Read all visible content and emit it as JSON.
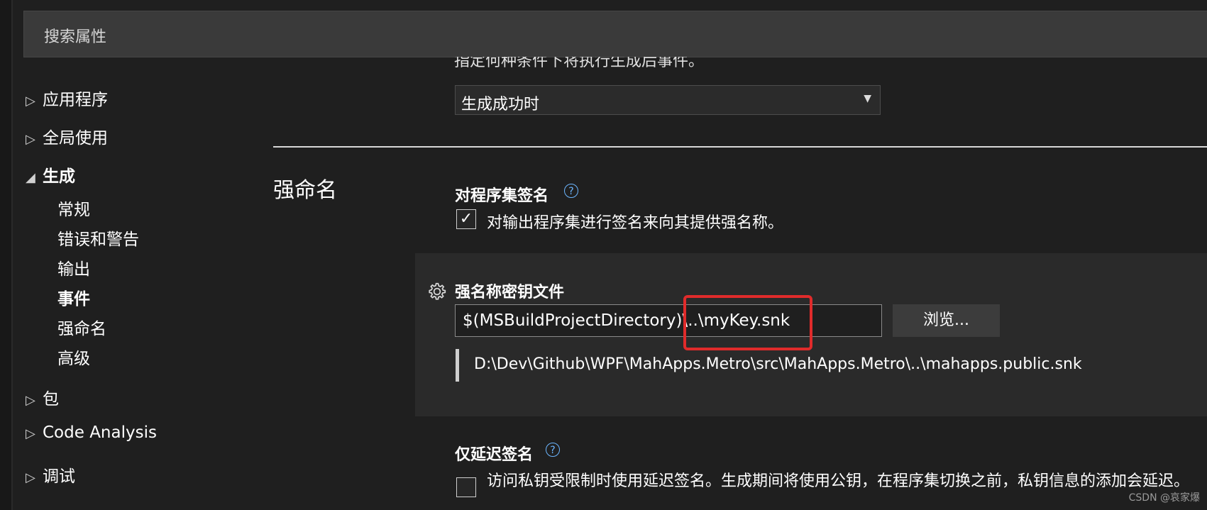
{
  "search": {
    "placeholder": "搜索属性"
  },
  "sidebar": {
    "items": [
      {
        "label": "应用程序",
        "state": "collapsed",
        "icon": "triangle-right-icon"
      },
      {
        "label": "全局使用",
        "state": "collapsed",
        "icon": "triangle-right-icon"
      },
      {
        "label": "生成",
        "state": "expanded",
        "icon": "triangle-down-icon",
        "children": [
          "常规",
          "错误和警告",
          "输出",
          "事件",
          "强命名",
          "高级"
        ],
        "active_child": "事件"
      },
      {
        "label": "包",
        "state": "collapsed",
        "icon": "triangle-right-icon"
      },
      {
        "label": "Code Analysis",
        "state": "collapsed",
        "icon": "triangle-right-icon"
      },
      {
        "label": "调试",
        "state": "collapsed",
        "icon": "triangle-right-icon"
      }
    ]
  },
  "events": {
    "cut_text": "指定何种条件下将执行生成后事件。",
    "dropdown_value": "生成成功时"
  },
  "strong_naming": {
    "section_title": "强命名",
    "sign_assembly": {
      "title": "对程序集签名",
      "checkbox_label": "对输出程序集进行签名来向其提供强名称。",
      "checked": true
    },
    "key_file": {
      "title": "强名称密钥文件",
      "value": "$(MSBuildProjectDirectory)\\..\\myKey.snk",
      "browse_label": "浏览...",
      "resolved_path": "D:\\Dev\\Github\\WPF\\MahApps.Metro\\src\\MahApps.Metro\\..\\mahapps.public.snk"
    },
    "delay_sign": {
      "title": "仅延迟签名",
      "checkbox_label": "访问私钥受限制时使用延迟签名。生成期间将使用公钥，在程序集切换之前，私钥信息的添加会延迟。",
      "checked": false
    }
  },
  "watermark": "CSDN @哀家爆",
  "colors": {
    "background": "#1f1f1f",
    "highlight": "#e02b2b",
    "help": "#6cb6ff"
  }
}
